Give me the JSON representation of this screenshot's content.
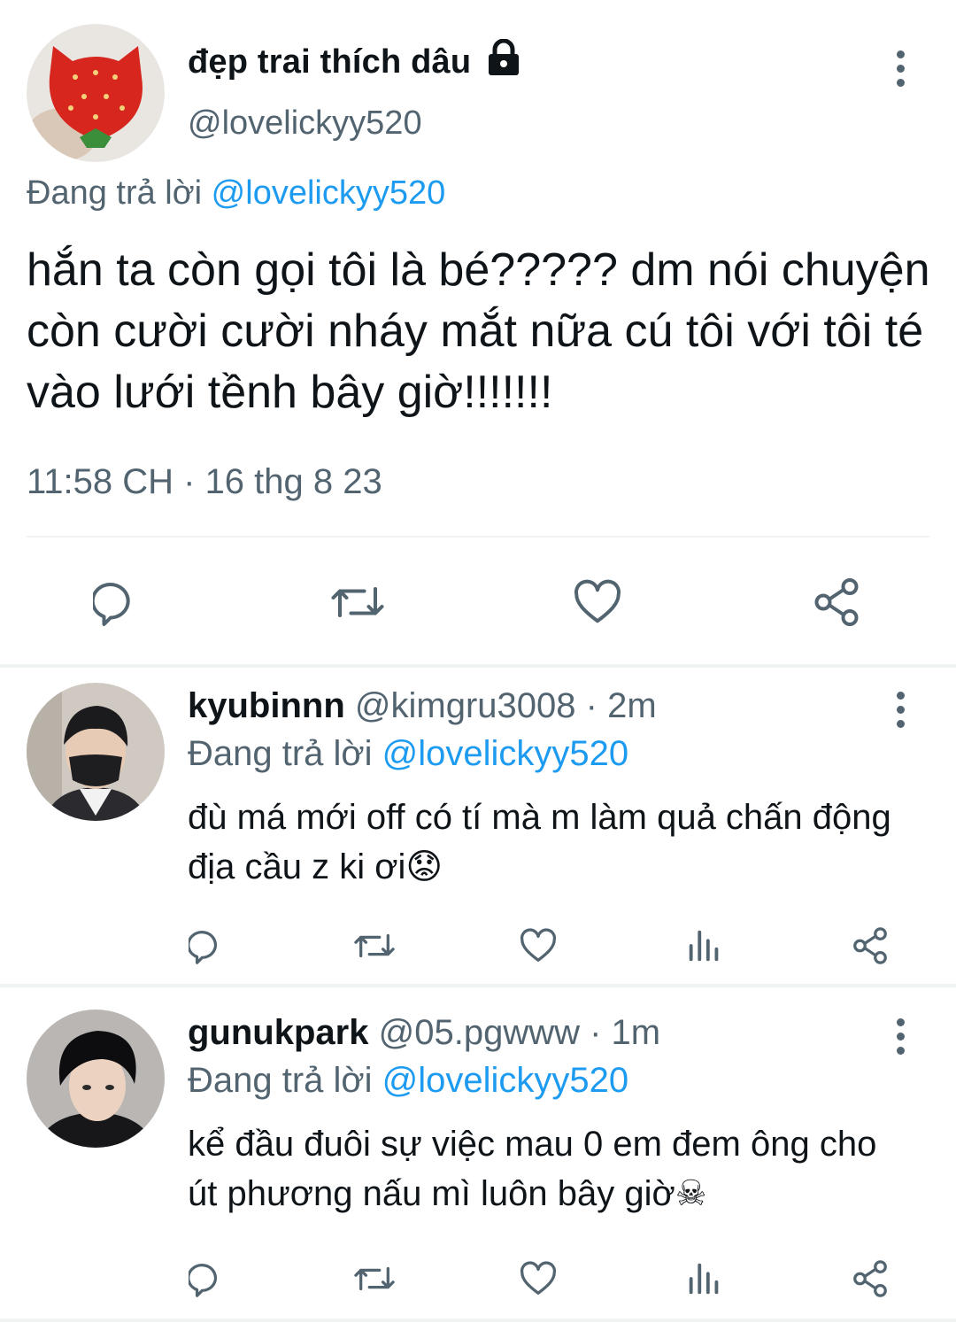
{
  "main_tweet": {
    "display_name": "đẹp trai thích dâu",
    "handle": "@lovelickyy520",
    "replying_prefix": "Đang trả lời",
    "replying_handle": "@lovelickyy520",
    "text": "hắn ta còn gọi tôi là bé????? dm nói chuyện còn cười cười nháy mắt nữa cú tôi với tôi té vào lưới tềnh bây giờ!!!!!!!",
    "timestamp": "11:58 CH · 16 thg 8 23",
    "icons": [
      "reply-icon",
      "retweet-icon",
      "like-icon",
      "share-icon"
    ]
  },
  "replies": [
    {
      "display_name": "kyubinnn",
      "handle": "@kimgru3008",
      "time": "· 2m",
      "replying_prefix": "Đang trả lời",
      "replying_handle": "@lovelickyy520",
      "text": "đù má mới off có tí mà m làm quả chấn động địa cầu z ki ơi",
      "emoji": "😟"
    },
    {
      "display_name": "gunukpark",
      "handle": "@05.pgwww",
      "time": "· 1m",
      "replying_prefix": "Đang trả lời",
      "replying_handle": "@lovelickyy520",
      "text": "kể đầu đuôi sự việc mau 0 em đem ông cho út phương nấu mì luôn bây giờ",
      "emoji": "☠"
    }
  ],
  "colors": {
    "link": "#1d9bf0",
    "muted": "#536471",
    "text": "#0f1419",
    "divider": "#eff3f4"
  }
}
